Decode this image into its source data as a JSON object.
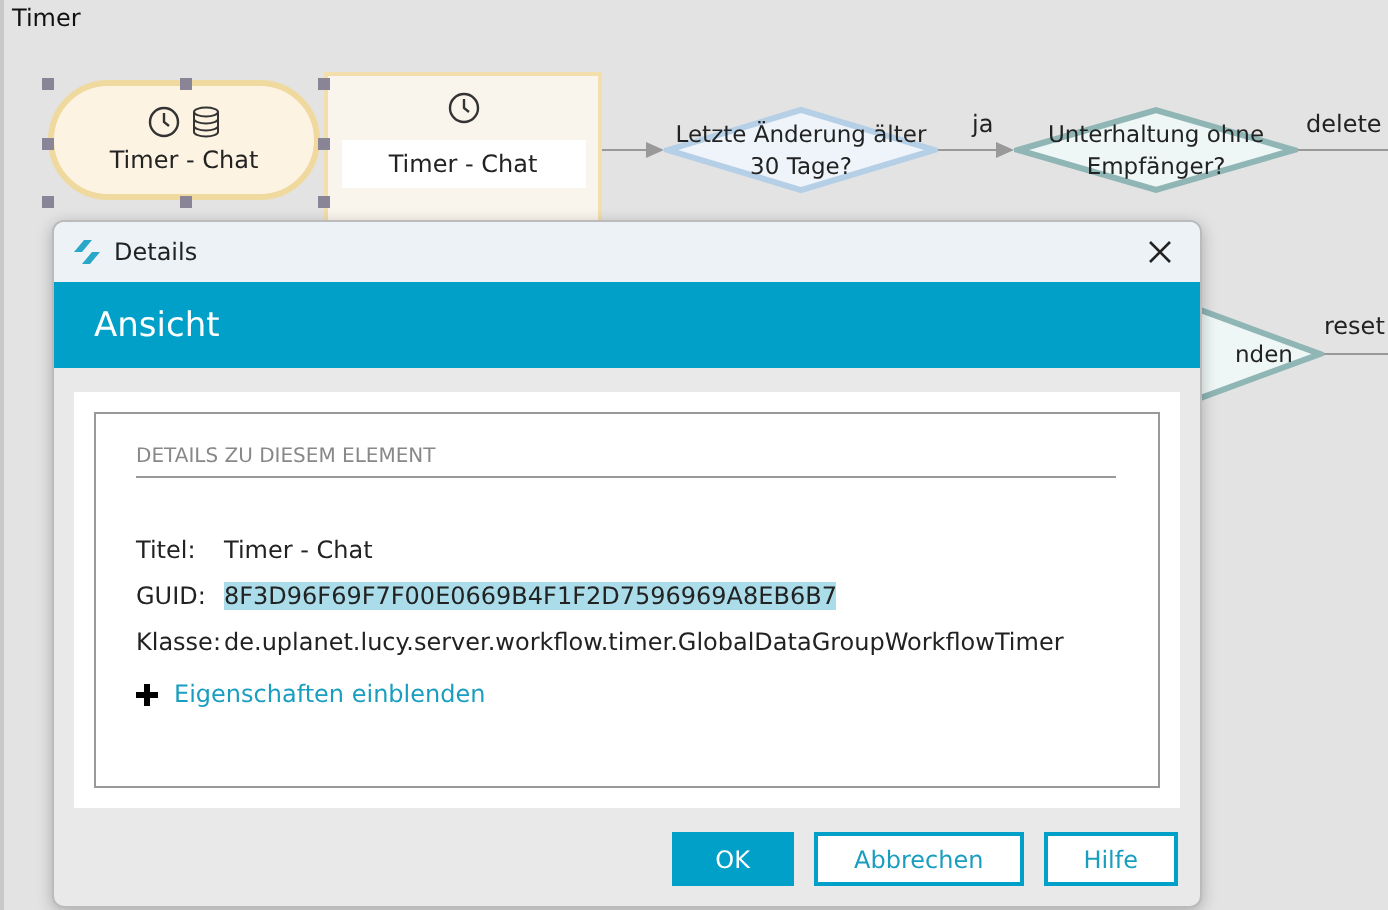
{
  "canvas": {
    "title": "Timer",
    "nodes": [
      {
        "kind": "start",
        "label": "Timer - Chat",
        "selected": true
      },
      {
        "kind": "task",
        "label": "Timer - Chat",
        "selected": false
      },
      {
        "kind": "decision",
        "label": "Letzte Änderung älter 30 Tage?"
      },
      {
        "kind": "decision2",
        "label": "Unterhaltung ohne Empfänger?"
      },
      {
        "kind": "decision3",
        "label": "nden"
      }
    ],
    "edge_labels": [
      "ja",
      "delete",
      "reset"
    ]
  },
  "dialog": {
    "title": "Details",
    "header": "Ansicht",
    "section_heading": "DETAILS ZU DIESEM ELEMENT",
    "fields": [
      {
        "label": "Titel:",
        "value": "Timer - Chat",
        "selected": false
      },
      {
        "label": "GUID:",
        "value": "8F3D96F69F7F00E0669B4F1F2D7596969A8EB6B7",
        "selected": true
      },
      {
        "label": "Klasse:",
        "value": "de.uplanet.lucy.server.workflow.timer.GlobalDataGroupWorkflowTimer",
        "selected": false
      }
    ],
    "expand_link": "Eigenschaften einblenden",
    "buttons": [
      {
        "label": "OK",
        "primary": true
      },
      {
        "label": "Abbrechen",
        "primary": false
      },
      {
        "label": "Hilfe",
        "primary": false
      }
    ]
  }
}
